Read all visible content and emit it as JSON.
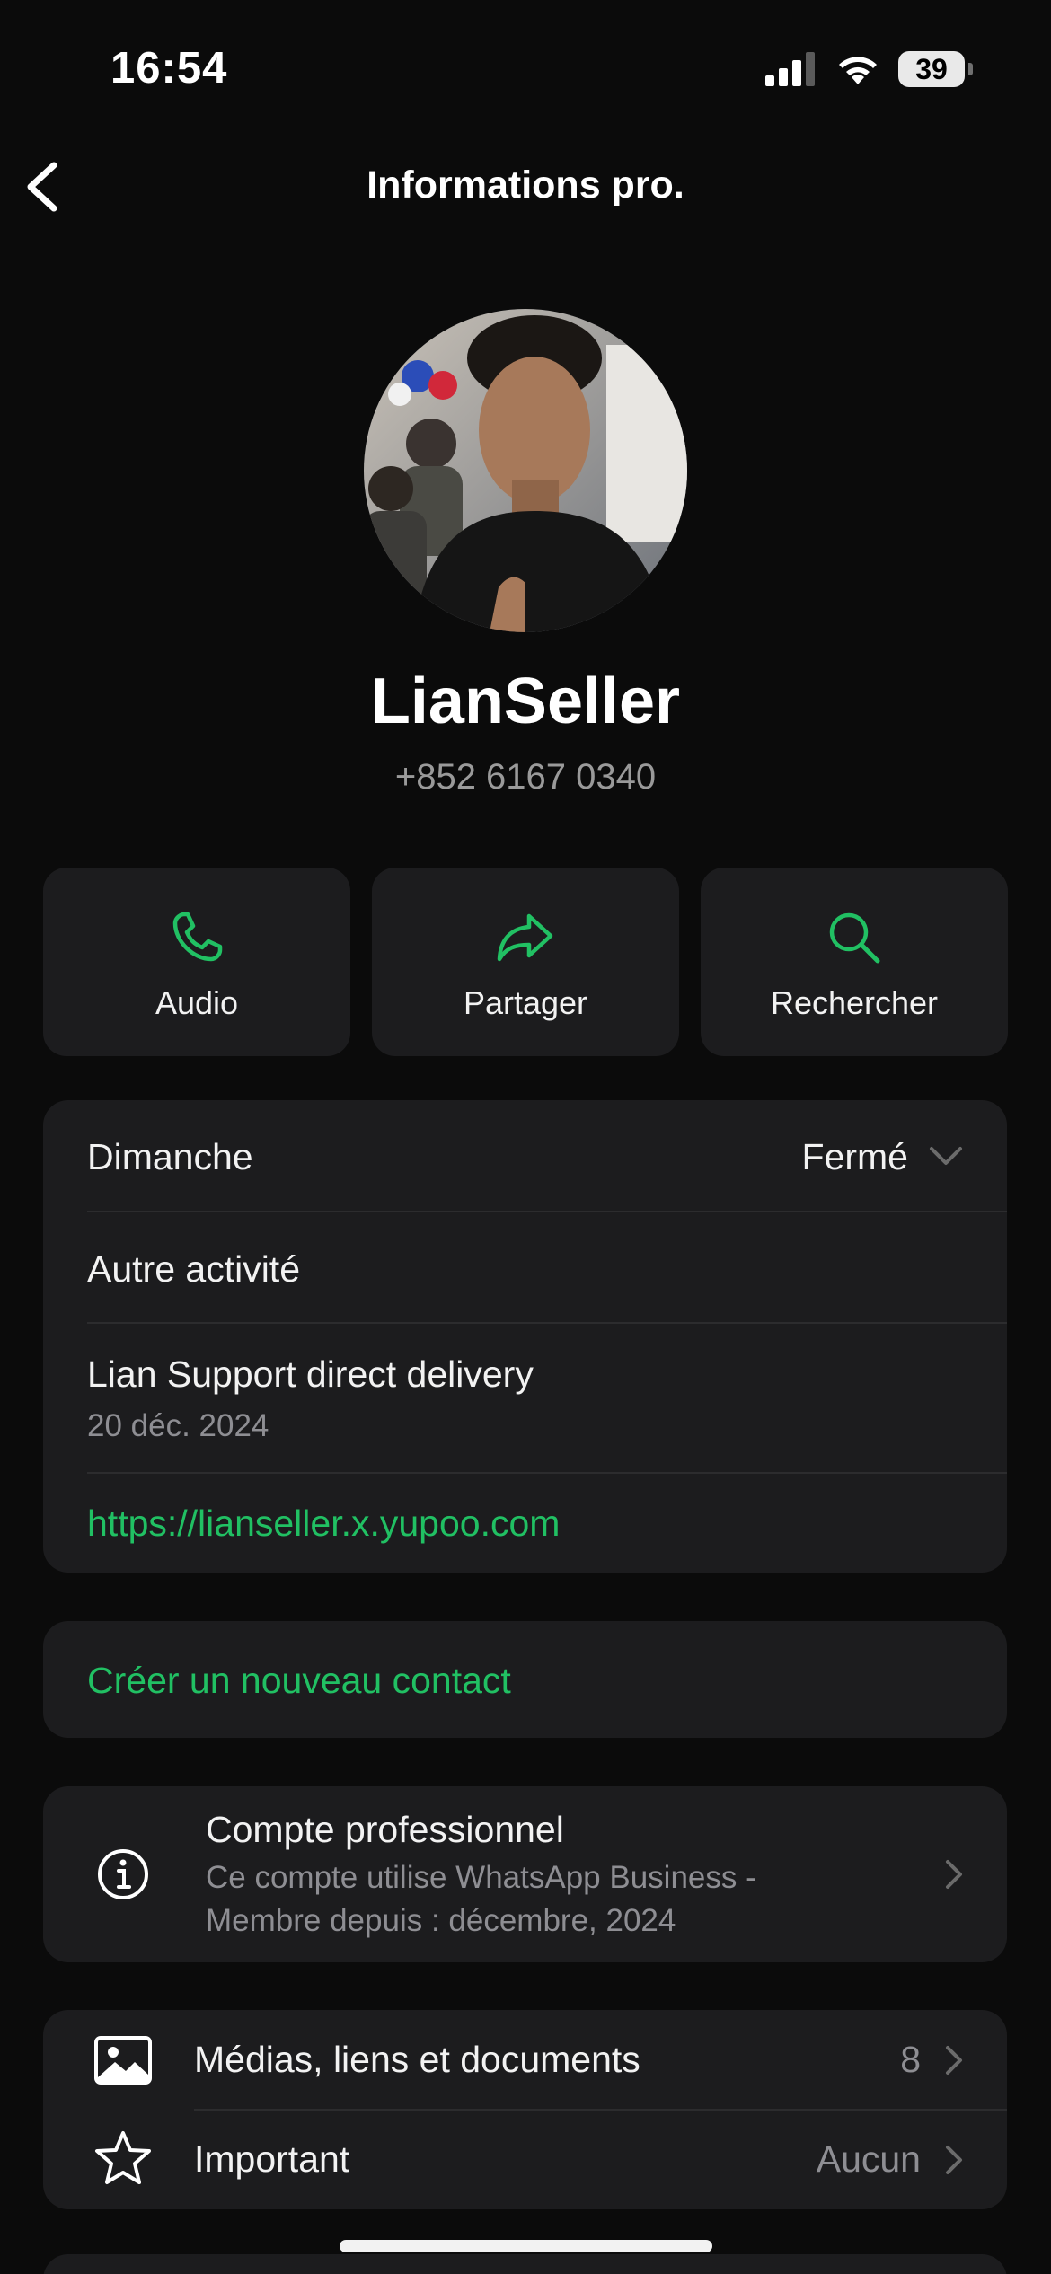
{
  "status_bar": {
    "time": "16:54",
    "battery": "39",
    "icons": [
      "cellular-signal-icon",
      "wifi-icon",
      "battery-icon"
    ]
  },
  "nav": {
    "title": "Informations pro.",
    "back_icon": "chevron-left-icon"
  },
  "profile": {
    "name": "LianSeller",
    "phone": "+852 6167 0340"
  },
  "actions": [
    {
      "label": "Audio",
      "icon": "phone-icon"
    },
    {
      "label": "Partager",
      "icon": "share-arrow-icon"
    },
    {
      "label": "Rechercher",
      "icon": "search-icon"
    }
  ],
  "business_info": {
    "hours_day": "Dimanche",
    "hours_status": "Fermé",
    "category": "Autre activité",
    "description": "Lian Support direct delivery",
    "description_date": "20 déc. 2024",
    "website": "https://lianseller.x.yupoo.com"
  },
  "create_contact": {
    "label": "Créer un nouveau contact"
  },
  "business_account": {
    "title": "Compte professionnel",
    "line1": "Ce compte utilise WhatsApp Business -",
    "line2": "Membre depuis : décembre, 2024"
  },
  "media": {
    "label": "Médias, liens et documents",
    "count": "8"
  },
  "starred": {
    "label": "Important",
    "value": "Aucun"
  },
  "colors": {
    "accent": "#21c063",
    "background": "#0b0b0b",
    "card": "#1c1c1e",
    "secondary_text": "#8e8e93"
  }
}
